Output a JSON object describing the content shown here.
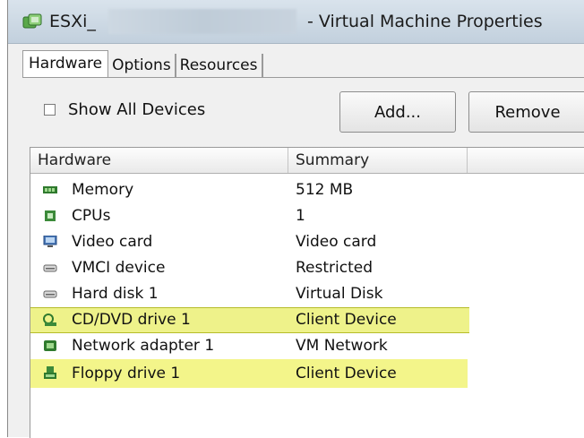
{
  "window": {
    "title_prefix": "ESXi_",
    "title_suffix": "- Virtual Machine Properties"
  },
  "tabs": [
    {
      "label": "Hardware",
      "active": true
    },
    {
      "label": "Options",
      "active": false
    },
    {
      "label": "Resources",
      "active": false
    }
  ],
  "toolbar": {
    "show_all_devices_label": "Show All Devices",
    "show_all_devices_checked": false,
    "add_label": "Add...",
    "remove_label": "Remove"
  },
  "table": {
    "columns": [
      "Hardware",
      "Summary"
    ],
    "rows": [
      {
        "name": "Memory",
        "summary": "512 MB",
        "icon": "memory-icon",
        "highlighted": false
      },
      {
        "name": "CPUs",
        "summary": "1",
        "icon": "cpu-icon",
        "highlighted": false
      },
      {
        "name": "Video card",
        "summary": "Video card",
        "icon": "monitor-icon",
        "highlighted": false
      },
      {
        "name": "VMCI device",
        "summary": "Restricted",
        "icon": "device-icon",
        "highlighted": false
      },
      {
        "name": "Hard disk 1",
        "summary": "Virtual Disk",
        "icon": "disk-icon",
        "highlighted": false
      },
      {
        "name": "CD/DVD drive 1",
        "summary": "Client Device",
        "icon": "cd-dvd-icon",
        "highlighted": true
      },
      {
        "name": "Network adapter 1",
        "summary": "VM Network",
        "icon": "network-icon",
        "highlighted": false
      },
      {
        "name": "Floppy drive 1",
        "summary": "Client Device",
        "icon": "floppy-icon",
        "highlighted": true
      }
    ]
  },
  "colors": {
    "highlight": "#f3f58a",
    "icon_green": "#3c8a3a"
  }
}
